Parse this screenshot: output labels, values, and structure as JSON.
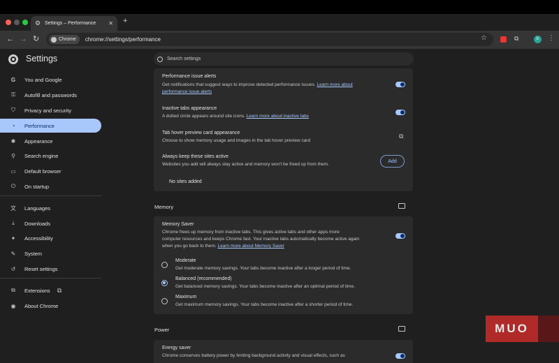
{
  "browser": {
    "tab_title": "Settings – Performance",
    "chip_label": "Chrome",
    "url": "chrome://settings/performance",
    "profile_initial": "k"
  },
  "header": {
    "title": "Settings",
    "search_placeholder": "Search settings"
  },
  "sidebar": {
    "items": [
      {
        "label": "You and Google",
        "icon": "google-icon"
      },
      {
        "label": "Autofill and passwords",
        "icon": "key-icon"
      },
      {
        "label": "Privacy and security",
        "icon": "shield-icon"
      },
      {
        "label": "Performance",
        "icon": "speedometer-icon",
        "active": true
      },
      {
        "label": "Appearance",
        "icon": "palette-icon"
      },
      {
        "label": "Search engine",
        "icon": "search-icon"
      },
      {
        "label": "Default browser",
        "icon": "browser-icon"
      },
      {
        "label": "On startup",
        "icon": "power-icon"
      },
      {
        "label": "Languages",
        "icon": "translate-icon"
      },
      {
        "label": "Downloads",
        "icon": "download-icon"
      },
      {
        "label": "Accessibility",
        "icon": "accessibility-icon"
      },
      {
        "label": "System",
        "icon": "wrench-icon"
      },
      {
        "label": "Reset settings",
        "icon": "reset-icon"
      },
      {
        "label": "Extensions",
        "icon": "puzzle-icon"
      },
      {
        "label": "About Chrome",
        "icon": "chrome-icon"
      }
    ]
  },
  "general_card": {
    "alerts_title": "Performance issue alerts",
    "alerts_desc": "Get notifications that suggest ways to improve detected performance issues. ",
    "alerts_link_1": "Learn more about",
    "alerts_link_2": "performance issue alerts",
    "alerts_enabled": true,
    "inactive_title": "Inactive tabs appearance",
    "inactive_desc": "A dotted circle appears around site icons. ",
    "inactive_link": "Learn more about inactive tabs",
    "inactive_enabled": true,
    "hover_title": "Tab hover preview card appearance",
    "hover_desc": "Choose to show memory usage and images in the tab hover preview card",
    "keep_title": "Always keep these sites active",
    "keep_desc": "Websites you add will always stay active and memory won't be freed up from them.",
    "add_label": "Add",
    "no_sites": "No sites added"
  },
  "memory": {
    "section_title": "Memory",
    "saver_title": "Memory Saver",
    "saver_desc_1": "Chrome frees up memory from inactive tabs. This gives active tabs and other apps more",
    "saver_desc_2": "computer resources and keeps Chrome fast. Your inactive tabs automatically become active again",
    "saver_desc_3": "when you go back to them. ",
    "saver_link": "Learn more about Memory Saver",
    "saver_enabled": true,
    "options": [
      {
        "title": "Moderate",
        "desc": "Get moderate memory savings. Your tabs become inactive after a longer period of time.",
        "selected": false
      },
      {
        "title": "Balanced (recommended)",
        "desc": "Get balanced memory savings. Your tabs become inactive after an optimal period of time.",
        "selected": true
      },
      {
        "title": "Maximum",
        "desc": "Get maximum memory savings. Your tabs become inactive after a shorter period of time.",
        "selected": false
      }
    ]
  },
  "power": {
    "section_title": "Power",
    "saver_title": "Energy saver",
    "saver_desc": "Chrome conserves battery power by limiting background activity and visual effects, such as",
    "saver_enabled": true
  },
  "watermark": "MUO",
  "colors": {
    "accent": "#a8c7fa",
    "background": "#1f1f1f",
    "card": "#2b2b2b"
  }
}
